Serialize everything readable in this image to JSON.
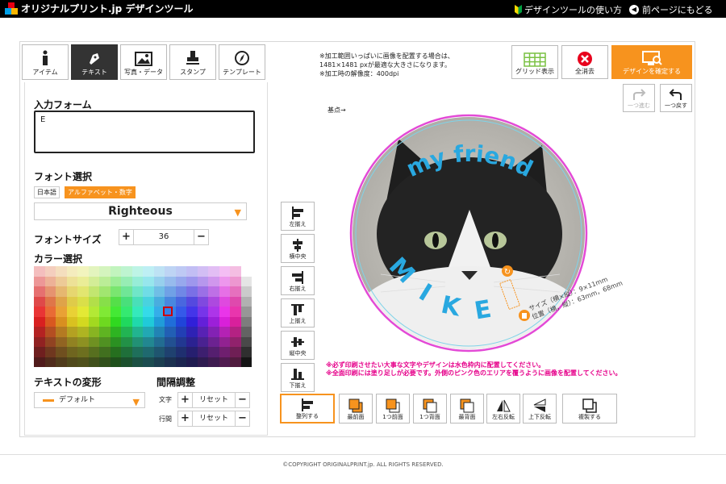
{
  "header": {
    "brand": "オリジナルプリント.jp デザインツール",
    "help_link": "デザインツールの使い方",
    "back_link": "前ページにもどる"
  },
  "tabs": [
    {
      "label": "アイテム",
      "icon": "info-icon",
      "active": false
    },
    {
      "label": "テキスト",
      "icon": "pen-icon",
      "active": true
    },
    {
      "label": "写真・データ",
      "icon": "image-icon",
      "active": false
    },
    {
      "label": "スタンプ",
      "icon": "stamp-icon",
      "active": false
    },
    {
      "label": "テンプレート",
      "icon": "compass-icon",
      "active": false
    }
  ],
  "text_panel": {
    "input_label": "入力フォーム",
    "input_value": "E",
    "font_label": "フォント選択",
    "font_tab_jp": "日本語",
    "font_tab_alpha": "アルファベット・数字",
    "font_name": "Righteous",
    "size_label": "フォントサイズ",
    "size_value": "36",
    "color_label": "カラー選択",
    "transform_label": "テキストの変形",
    "transform_value": "デフォルト",
    "spacing_label": "間隔調整",
    "char_label": "文字",
    "line_label": "行間",
    "reset_label": "リセット"
  },
  "notes": {
    "line1": "※加工範囲いっぱいに画像を配置する場合は、",
    "line2": "1481×1481 pxが最適な大きさになります。",
    "line3": "※加工時の解像度：400dpi",
    "base_point": "基点→"
  },
  "toolbar": {
    "grid": "グリッド表示",
    "clear": "全消去",
    "confirm": "デザインを確定する",
    "redo": "一つ進む",
    "undo": "一つ戻す"
  },
  "align_buttons": [
    "左揃え",
    "横中央",
    "右揃え",
    "上揃え",
    "縦中央",
    "下揃え"
  ],
  "bottom_buttons": [
    "整列する",
    "最前面",
    "1つ前面",
    "1つ背面",
    "最背面",
    "左右反転",
    "上下反転",
    "複製する"
  ],
  "canvas": {
    "text_top": "my friend",
    "text_bottom": "MIKE",
    "size_line1": "サイズ（横×縦）：9×11mm",
    "size_line2": "位置（横，縦）：63mm，68mm"
  },
  "warnings": {
    "w1": "※必ず印刷させたい大事な文字やデザインは水色枠内に配置してください。",
    "w2": "※全面印刷には塗り足しが必要です。外側のピンク色のエリアを覆うように画像を配置してください。"
  },
  "footer": "©COPYRIGHT ORIGINALPRINT.jp. ALL RIGHTS RESERVED.",
  "colors": {
    "accent": "#f7931e",
    "bleed": "#e6008a",
    "safe": "#7fd3e8",
    "text_blue": "#29a8e0",
    "selection": "#cc0000"
  }
}
